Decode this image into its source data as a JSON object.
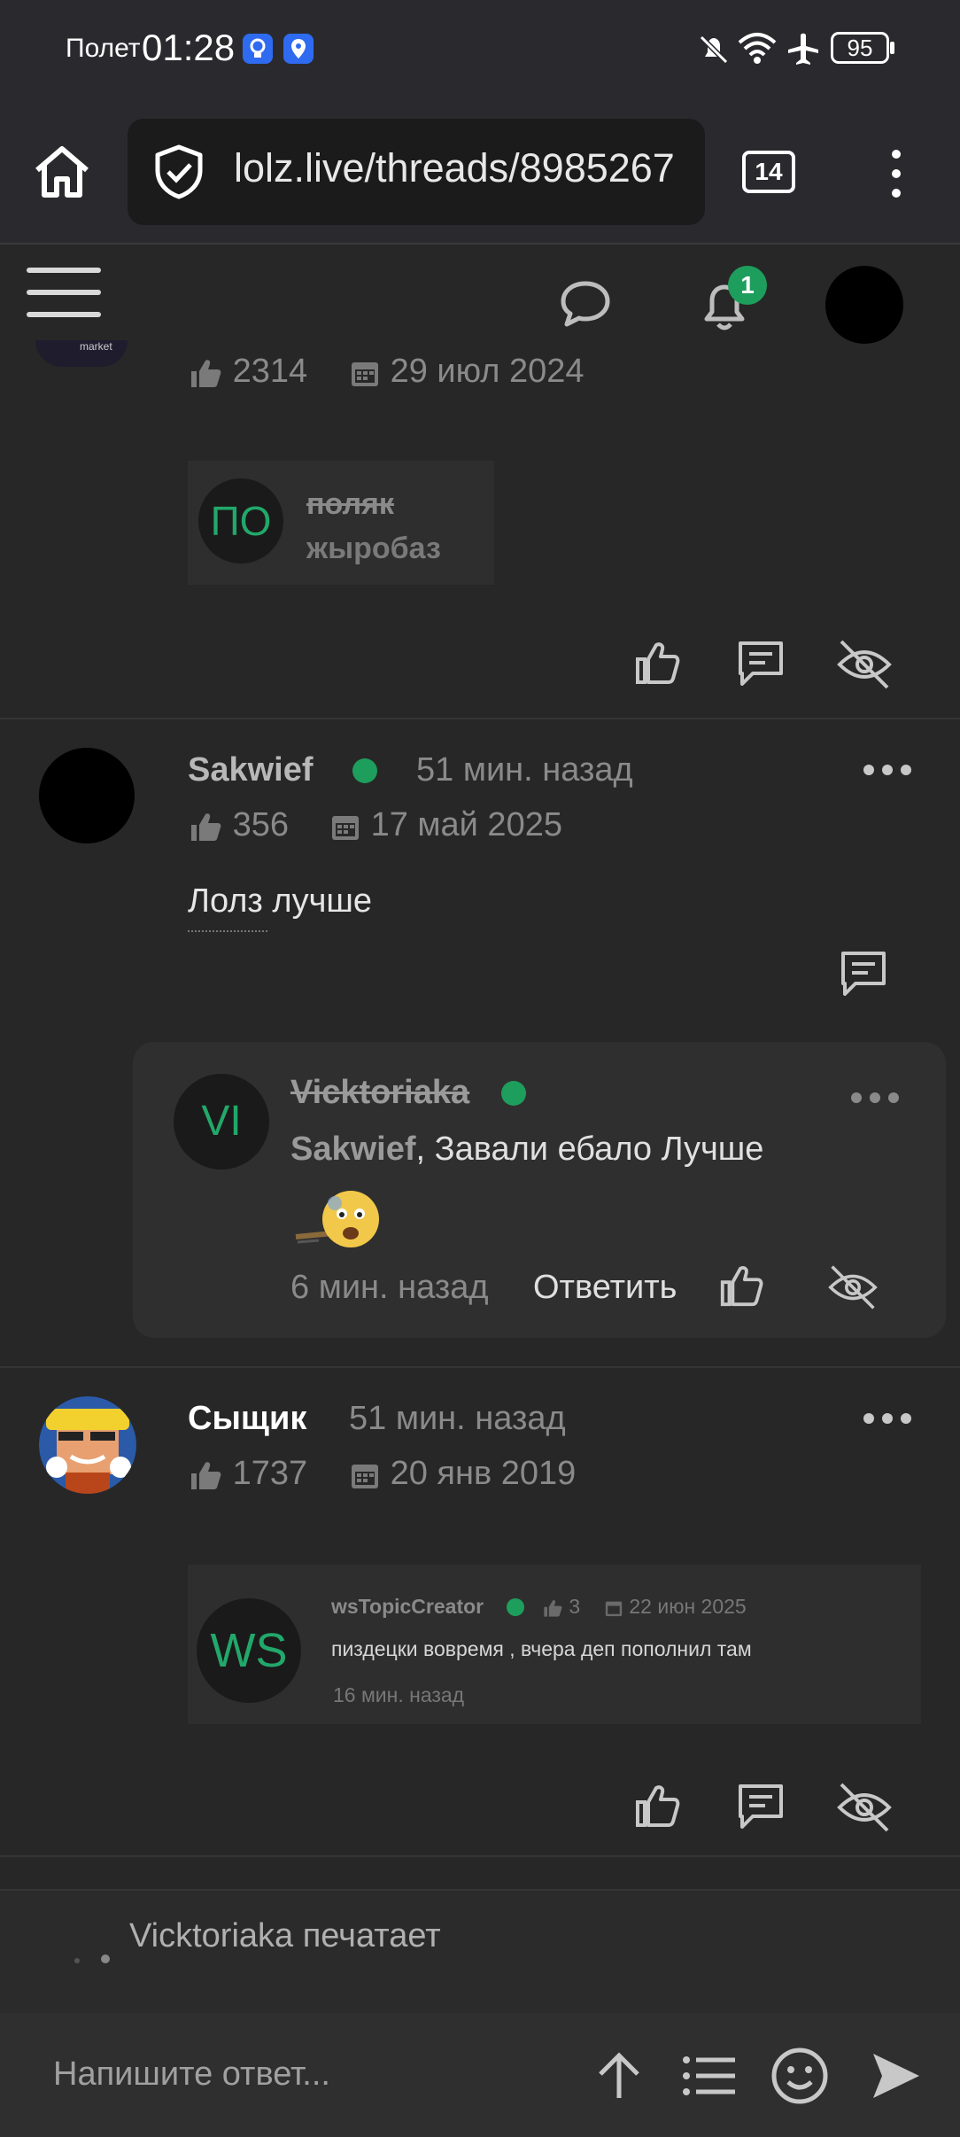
{
  "status": {
    "mode": "Полет",
    "time": "01:28",
    "battery": "95"
  },
  "browser": {
    "url": "lolz.live/threads/8985267",
    "tab_count": "14"
  },
  "header": {
    "notification_count": "1"
  },
  "post1": {
    "likes": "2314",
    "join_date": "29 июл 2024",
    "avatar_text": "market",
    "embed": {
      "initials": "ПО",
      "name": "поляк",
      "subtitle": "жыробаз"
    }
  },
  "post2": {
    "username": "Sakwief",
    "time": "51 мин. назад",
    "likes": "356",
    "join_date": "17 май 2025",
    "body": "Лолз лучше",
    "reply": {
      "initials": "VI",
      "username": "Vicktoriaka",
      "mention": "Sakwief",
      "text": ", Завали ебало Лучше",
      "time": "6 мин. назад",
      "reply_label": "Ответить"
    }
  },
  "post3": {
    "username": "Сыщик",
    "time": "51 мин. назад",
    "likes": "1737",
    "join_date": "20 янв 2019",
    "embed": {
      "initials": "WS",
      "username": "wsTopicCreator",
      "likes": "3",
      "date": "22 июн 2025",
      "text": "пиздецки вовремя , вчера деп пополнил там",
      "time": "16 мин. назад"
    }
  },
  "typing": {
    "text": "Vicktoriaka печатает"
  },
  "composer": {
    "placeholder": "Напишите ответ..."
  },
  "colors": {
    "accent_green": "#1e9e5c",
    "background": "#272727"
  }
}
